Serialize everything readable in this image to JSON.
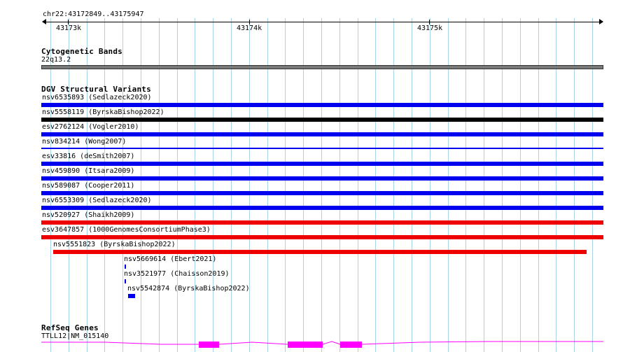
{
  "ruler": {
    "region": "chr22:43172849..43175947",
    "ticks": [
      "43173k",
      "43174k",
      "43175k"
    ]
  },
  "cytoband": {
    "title": "Cytogenetic Bands",
    "band": "22q13.2"
  },
  "dgv": {
    "title": "DGV Structural Variants",
    "features": [
      {
        "label": "nsv6535893 (Sedlazeck2020)",
        "color": "#0000ee"
      },
      {
        "label": "nsv5558119 (ByrskaBishop2022)",
        "color": "#000000"
      },
      {
        "label": "esv2762124 (Vogler2010)",
        "color": "#0000ee"
      },
      {
        "label": "nsv834214 (Wong2007)",
        "color": "#0000ee"
      },
      {
        "label": "esv33816 (deSmith2007)",
        "color": "#0000ee"
      },
      {
        "label": "nsv459890 (Itsara2009)",
        "color": "#0000ee"
      },
      {
        "label": "nsv589087 (Cooper2011)",
        "color": "#0000ee"
      },
      {
        "label": "nsv6553309 (Sedlazeck2020)",
        "color": "#0000ee"
      },
      {
        "label": "nsv520927 (Shaikh2009)",
        "color": "#ee0000"
      },
      {
        "label": "esv3647857 (1000GenomesConsortiumPhase3)",
        "color": "#ee0000"
      },
      {
        "label": "nsv5551823 (ByrskaBishop2022)",
        "color": "#ee0000"
      },
      {
        "label": "nsv5669614 (Ebert2021)",
        "color": "#0000ee"
      },
      {
        "label": "nsv3521977 (Chaisson2019)",
        "color": "#0000ee"
      },
      {
        "label": "nsv5542874 (ByrskaBishop2022)",
        "color": "#0000ee"
      }
    ]
  },
  "refseq": {
    "title": "RefSeq Genes",
    "gene": "TTLL12|NM_015140",
    "color": "#ff00ff"
  }
}
